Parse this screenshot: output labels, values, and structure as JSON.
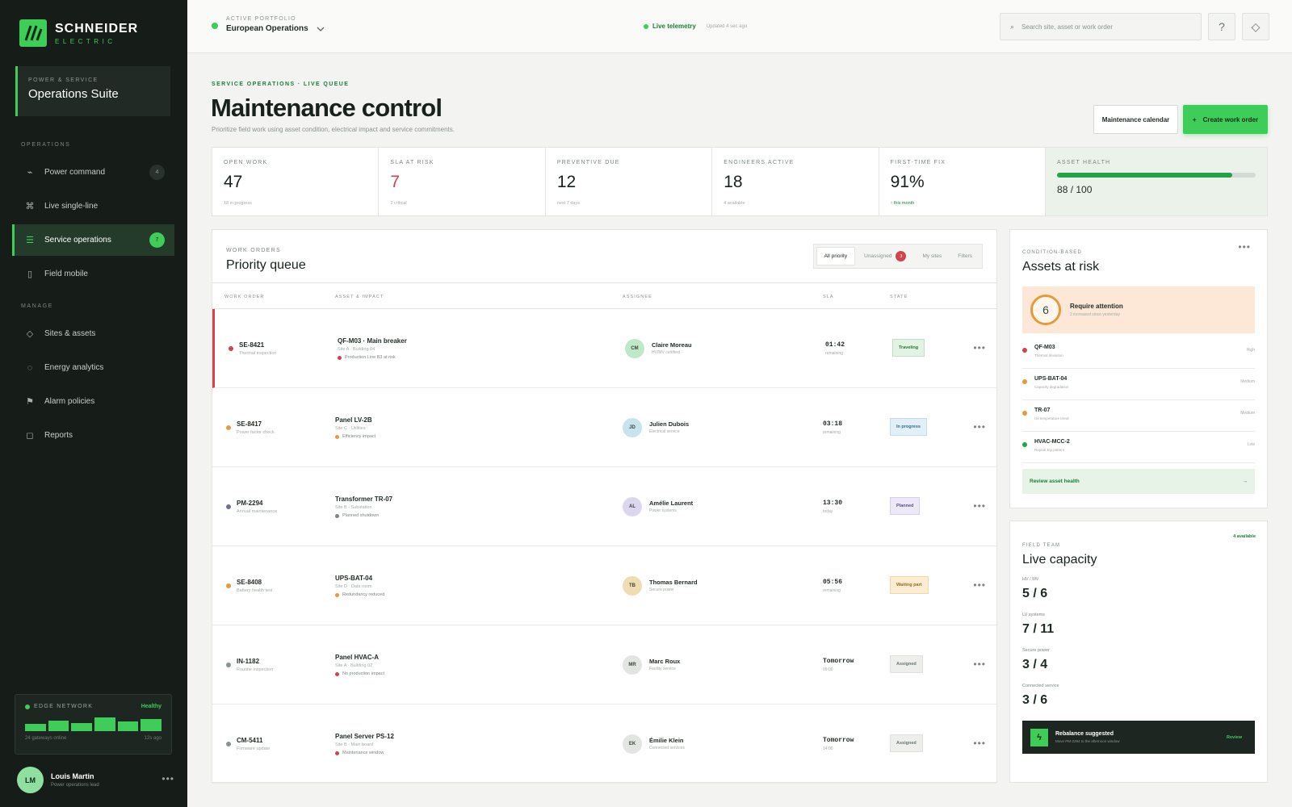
{
  "brand": {
    "name": "SCHNEIDER",
    "sub": "ELECTRIC"
  },
  "suite": {
    "kicker": "POWER & SERVICE",
    "name": "Operations Suite"
  },
  "nav": {
    "operations_label": "OPERATIONS",
    "manage_label": "MANAGE",
    "operations": [
      {
        "label": "Power command",
        "icon": "⌁",
        "count": "4"
      },
      {
        "label": "Live single-line",
        "icon": "⌘",
        "count": ""
      },
      {
        "label": "Service operations",
        "icon": "☰",
        "count": "7"
      },
      {
        "label": "Field mobile",
        "icon": "▯",
        "count": ""
      }
    ],
    "manage": [
      {
        "label": "Sites & assets",
        "icon": "◇"
      },
      {
        "label": "Energy analytics",
        "icon": "◌"
      },
      {
        "label": "Alarm policies",
        "icon": "⚑"
      },
      {
        "label": "Reports",
        "icon": "◻"
      }
    ]
  },
  "edge": {
    "label": "EDGE NETWORK",
    "status": "Healthy",
    "foot_left": "24 gateways online",
    "foot_right": "12s ago",
    "bars": [
      0.5,
      0.75,
      0.55,
      0.95,
      0.65,
      0.85
    ]
  },
  "user": {
    "initials": "LM",
    "name": "Louis Martin",
    "role": "Power operations lead"
  },
  "topbar": {
    "portfolio_label": "ACTIVE PORTFOLIO",
    "portfolio": "European Operations",
    "telemetry": "Live telemetry",
    "updated": "Updated 4 sec ago",
    "search_placeholder": "Search site, asset or work order"
  },
  "header": {
    "crumb": "SERVICE OPERATIONS · LIVE QUEUE",
    "title": "Maintenance control",
    "subtitle": "Prioritize field work using asset condition, electrical impact and service commitments.",
    "calendar_btn": "Maintenance calendar",
    "create_btn": "Create work order"
  },
  "kpis": [
    {
      "label": "OPEN WORK",
      "value": "47",
      "sub": "18 in progress"
    },
    {
      "label": "SLA AT RISK",
      "value": "7",
      "sub": "2 critical"
    },
    {
      "label": "PREVENTIVE DUE",
      "value": "12",
      "sub": "next 7 days"
    },
    {
      "label": "ENGINEERS ACTIVE",
      "value": "18",
      "sub": "4 available"
    },
    {
      "label": "FIRST-TIME FIX",
      "value": "91%",
      "sub": "↑ this month"
    }
  ],
  "health": {
    "label": "ASSET HEALTH",
    "value": "88 / 100",
    "score": 0.88
  },
  "queue": {
    "kicker": "WORK ORDERS",
    "title": "Priority queue",
    "filters": [
      "All priority",
      "Unassigned",
      "My sites",
      "Filters"
    ],
    "unassigned_count": "3",
    "columns": [
      "WORK ORDER",
      "ASSET & IMPACT",
      "ASSIGNEE",
      "SLA",
      "STATE"
    ],
    "rows": [
      {
        "id": "SE-8421",
        "type": "Thermal inspection",
        "asset": "QF-M03 · Main breaker",
        "site": "Site A · Building 04",
        "impact": "Production Line B3 at risk",
        "initials": "CM",
        "assignee": "Claire Moreau",
        "role": "HV/MV certified",
        "sla": "01:42",
        "sla_sub": "remaining",
        "state": "Traveling"
      },
      {
        "id": "SE-8417",
        "type": "Power factor check",
        "asset": "Panel LV-2B",
        "site": "Site C · Utilities",
        "impact": "Efficiency impact",
        "initials": "JD",
        "assignee": "Julien Dubois",
        "role": "Electrical service",
        "sla": "03:18",
        "sla_sub": "remaining",
        "state": "In progress"
      },
      {
        "id": "PM-2294",
        "type": "Annual maintenance",
        "asset": "Transformer TR-07",
        "site": "Site B · Substation",
        "impact": "Planned shutdown",
        "initials": "AL",
        "assignee": "Amélie Laurent",
        "role": "Power systems",
        "sla": "13:30",
        "sla_sub": "today",
        "state": "Planned"
      },
      {
        "id": "SE-8408",
        "type": "Battery health test",
        "asset": "UPS-BAT-04",
        "site": "Site D · Data room",
        "impact": "Redundancy reduced",
        "initials": "TB",
        "assignee": "Thomas Bernard",
        "role": "Secure power",
        "sla": "05:56",
        "sla_sub": "remaining",
        "state": "Waiting part"
      },
      {
        "id": "IN-1182",
        "type": "Routine inspection",
        "asset": "Panel HVAC-A",
        "site": "Site A · Building 02",
        "impact": "No production impact",
        "initials": "MR",
        "assignee": "Marc Roux",
        "role": "Facility service",
        "sla": "Tomorrow",
        "sla_sub": "09:00",
        "state": "Assigned"
      },
      {
        "id": "CM-5411",
        "type": "Firmware update",
        "asset": "Panel Server PS-12",
        "site": "Site B · Main board",
        "impact": "Maintenance window",
        "initials": "EK",
        "assignee": "Émilie Klein",
        "role": "Connected services",
        "sla": "Tomorrow",
        "sla_sub": "14:00",
        "state": "Assigned"
      }
    ]
  },
  "risk": {
    "kicker": "CONDITION-BASED",
    "title": "Assets at risk",
    "count": "6",
    "attention": "Require attention",
    "attention_sub": "2 increased since yesterday",
    "items": [
      {
        "name": "QF-M03",
        "detail": "Thermal deviation",
        "level": "High"
      },
      {
        "name": "UPS-BAT-04",
        "detail": "Capacity degradation",
        "level": "Medium"
      },
      {
        "name": "TR-07",
        "detail": "Oil temperature trend",
        "level": "Medium"
      },
      {
        "name": "HVAC-MCC-2",
        "detail": "Repeat trip pattern",
        "level": "Low"
      }
    ],
    "review": "Review asset health"
  },
  "capacity": {
    "kicker": "FIELD TEAM",
    "title": "Live capacity",
    "available": "4 available",
    "rows": [
      {
        "label": "HV / MV",
        "value": "5 / 6"
      },
      {
        "label": "LV systems",
        "value": "7 / 11"
      },
      {
        "label": "Secure power",
        "value": "3 / 4"
      },
      {
        "label": "Connected service",
        "value": "3 / 6"
      }
    ],
    "rebalance": "Rebalance suggested",
    "rebalance_sub": "Move PM-2294 to the afternoon window",
    "review": "Review"
  },
  "colors": {
    "accent": "#3dcd58",
    "critical": "#d0444c",
    "warning": "#e39b3c",
    "sidebar": "#161c18"
  }
}
